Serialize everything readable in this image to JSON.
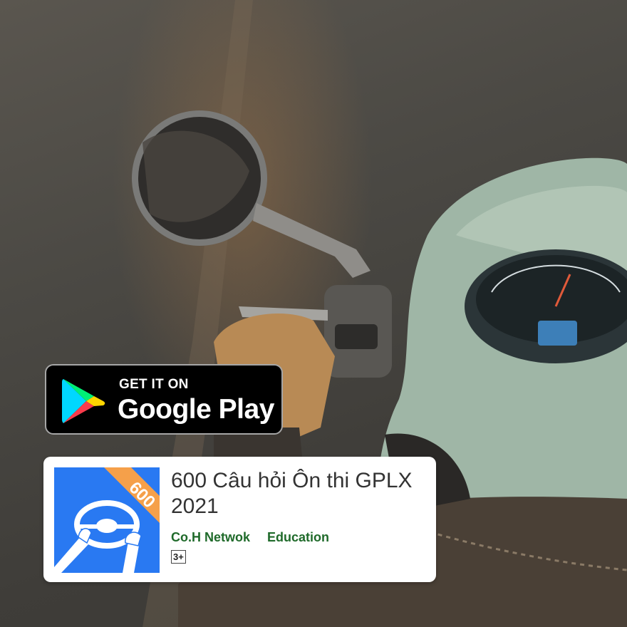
{
  "background": {
    "description_icon": "scooter-photo"
  },
  "badge": {
    "get_it_on": "GET IT ON",
    "store_name": "Google Play",
    "icon": "google-play-icon"
  },
  "app": {
    "title": "600 Câu hỏi Ôn thi GPLX 2021",
    "developer": "Co.H Netwok",
    "category": "Education",
    "content_rating": "3+",
    "icon_ribbon": "600",
    "icon": "steering-wheel-icon",
    "brand_color": "#2979f2",
    "ribbon_color": "#f5a04a"
  }
}
